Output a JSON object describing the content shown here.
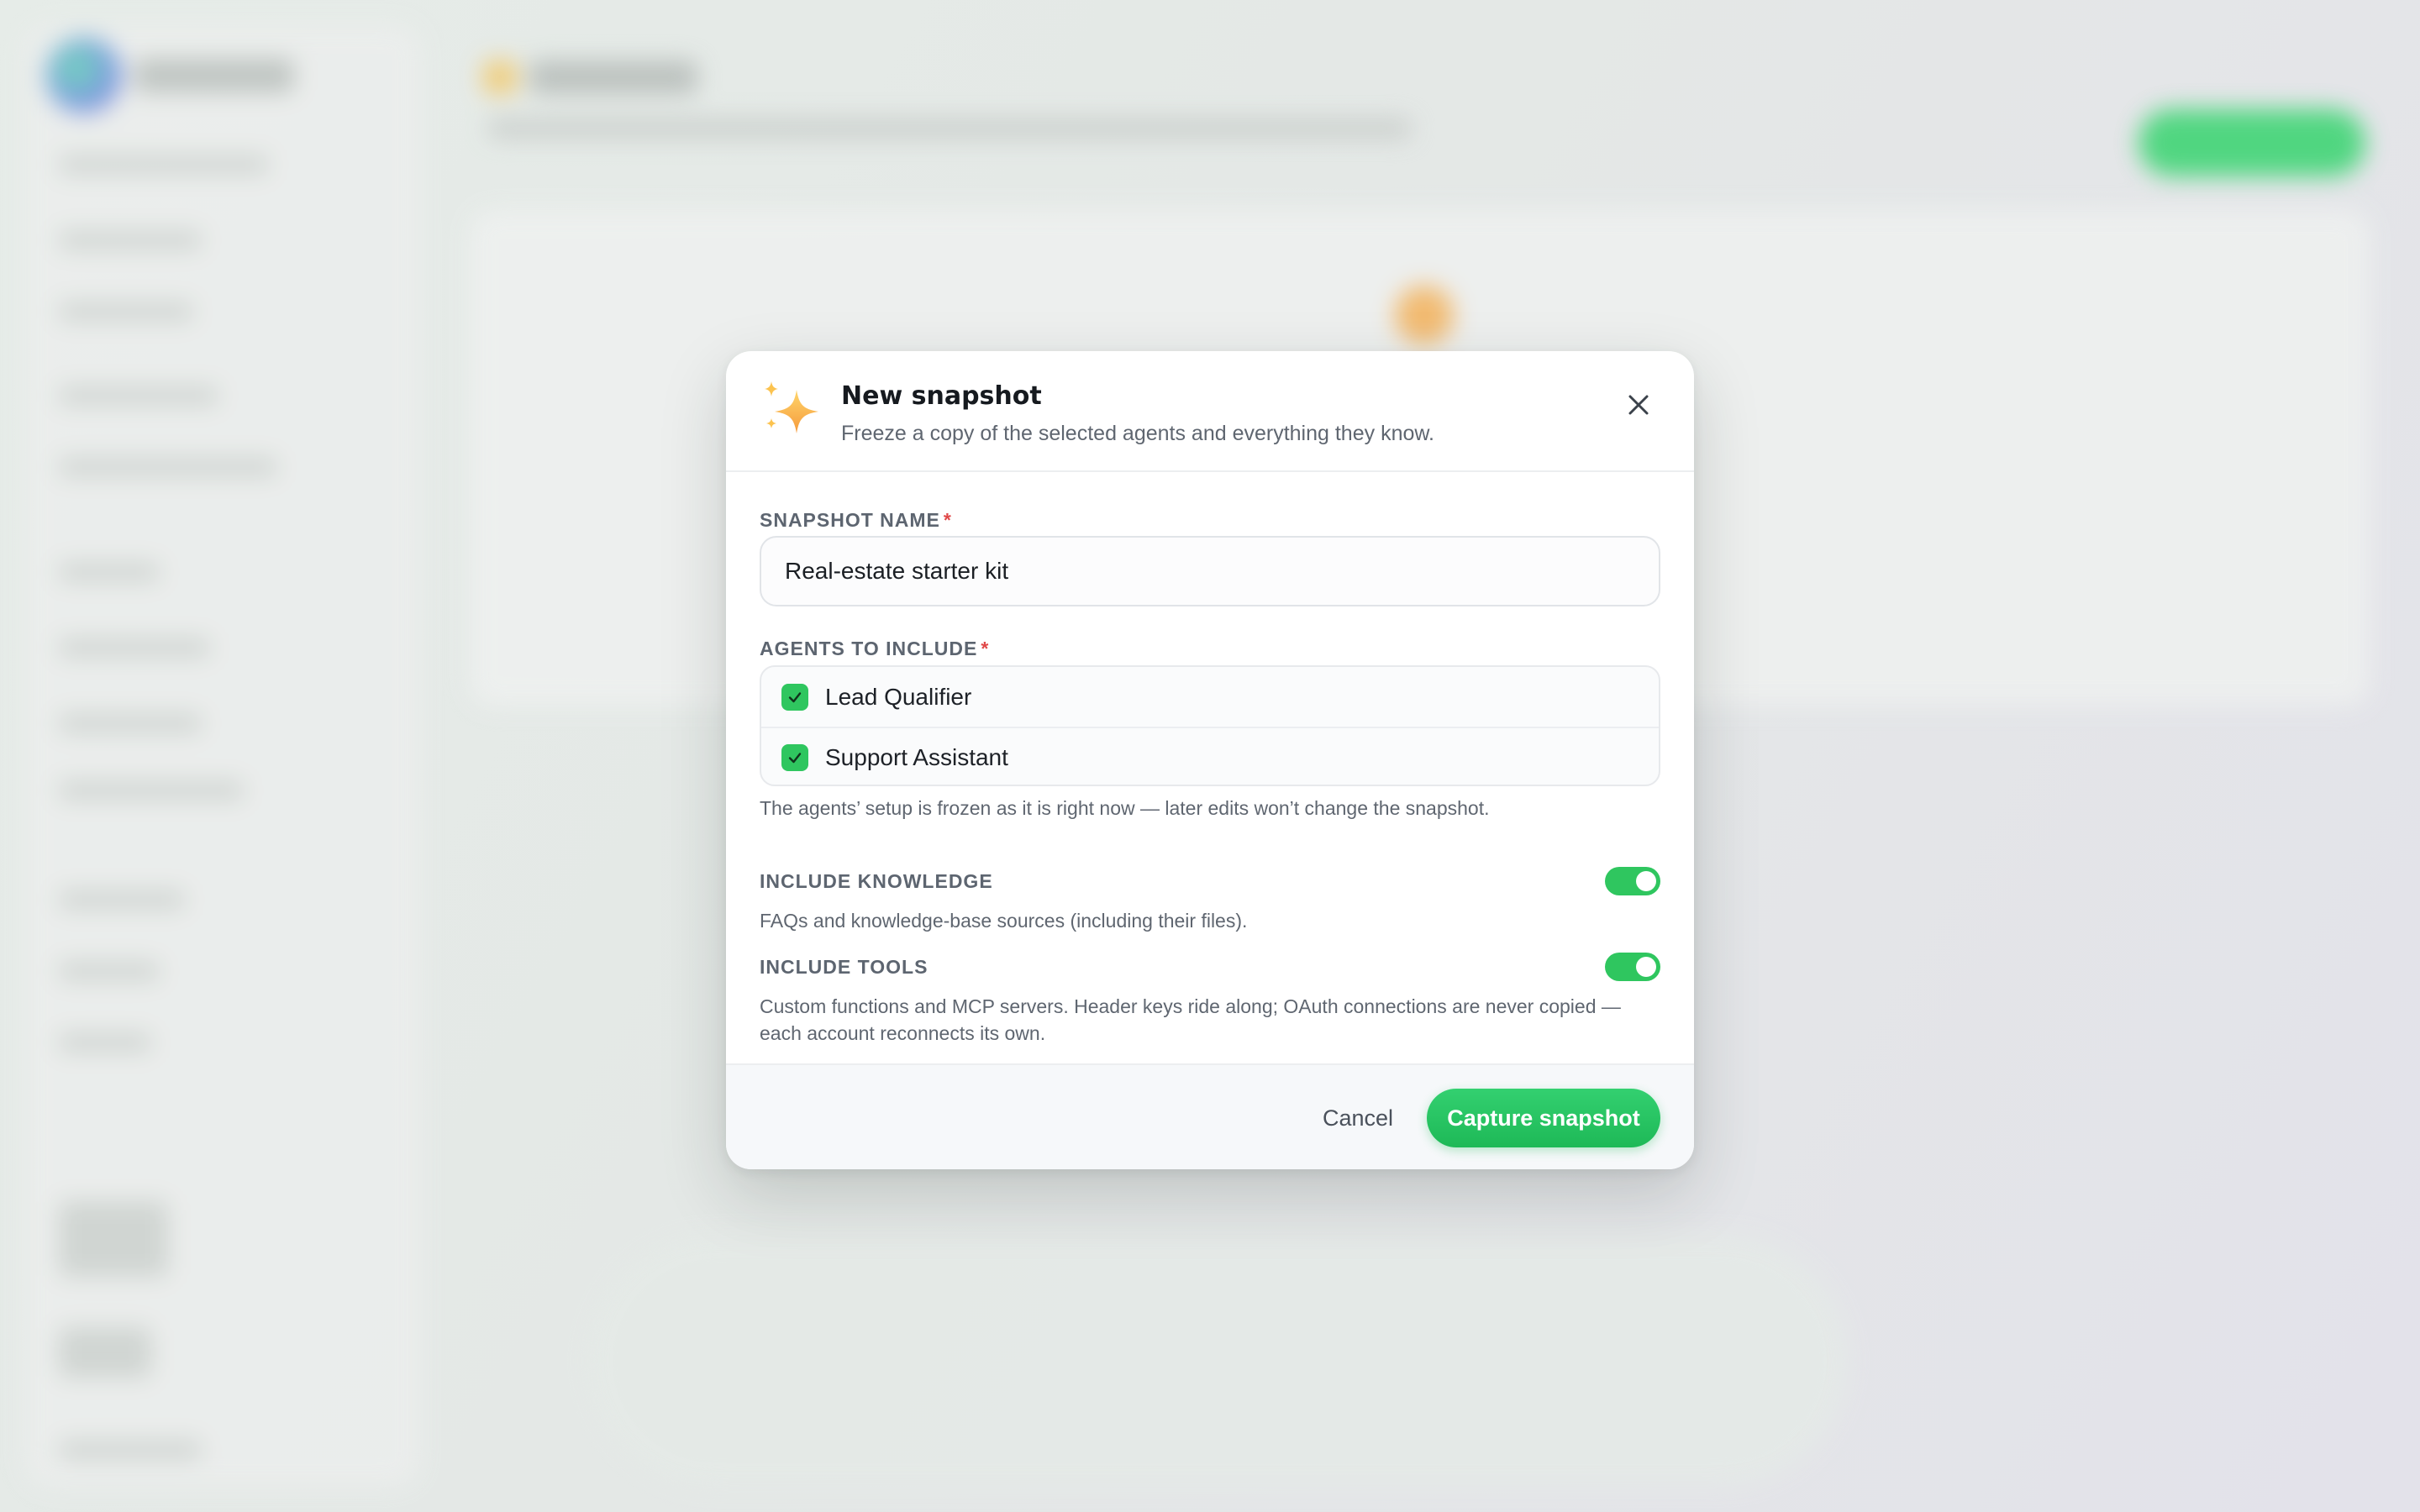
{
  "modal": {
    "title": "New snapshot",
    "subtitle": "Freeze a copy of the selected agents and everything they know.",
    "header_icon": "sparkles-icon",
    "close_icon": "close-icon"
  },
  "form": {
    "snapshot_name": {
      "label": "SNAPSHOT NAME",
      "required_marker": "*",
      "value": "Real-estate starter kit"
    },
    "agents": {
      "label": "AGENTS TO INCLUDE",
      "required_marker": "*",
      "items": [
        {
          "name": "Lead Qualifier",
          "checked": true
        },
        {
          "name": "Support Assistant",
          "checked": true
        }
      ],
      "hint": "The agents’ setup is frozen as it is right now — later edits won’t change the snapshot."
    },
    "include_knowledge": {
      "label": "INCLUDE KNOWLEDGE",
      "enabled": true,
      "hint": "FAQs and knowledge-base sources (including their files)."
    },
    "include_tools": {
      "label": "INCLUDE TOOLS",
      "enabled": true,
      "hint_line1": "Custom functions and MCP servers. Header keys ride along; OAuth connections are never copied —",
      "hint_line2": "each account reconnects its own."
    }
  },
  "footer": {
    "cancel_label": "Cancel",
    "capture_label": "Capture snapshot"
  },
  "colors": {
    "accent": "#2fc65f",
    "required": "#e04848"
  }
}
